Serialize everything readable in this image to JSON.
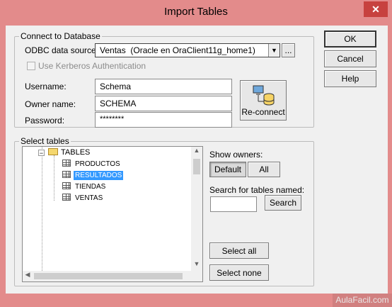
{
  "window": {
    "title": "Import Tables",
    "close_glyph": "✕"
  },
  "connect": {
    "group_label": "Connect to Database",
    "odbc_label": "ODBC data source:",
    "odbc_value": "Ventas  (Oracle en OraClient11g_home1)",
    "browse_label": "...",
    "kerberos_label": "Use Kerberos Authentication",
    "kerberos_checked": false,
    "username_label": "Username:",
    "username_value": "Schema",
    "owner_label": "Owner name:",
    "owner_value": "SCHEMA",
    "password_label": "Password:",
    "password_value": "********",
    "reconnect_label": "Re-connect"
  },
  "buttons": {
    "ok": "OK",
    "cancel": "Cancel",
    "help": "Help"
  },
  "select_tables": {
    "group_label": "Select tables",
    "tree": {
      "root": "TABLES",
      "items": [
        {
          "label": "PRODUCTOS",
          "selected": false
        },
        {
          "label": "RESULTADOS",
          "selected": true
        },
        {
          "label": "TIENDAS",
          "selected": false
        },
        {
          "label": "VENTAS",
          "selected": false
        }
      ]
    },
    "show_owners_label": "Show owners:",
    "default_label": "Default",
    "all_label": "All",
    "search_label": "Search for tables named:",
    "search_value": "",
    "search_button": "Search",
    "select_all": "Select all",
    "select_none": "Select none"
  },
  "status": {
    "watermark": "AulaFacil.com"
  },
  "colors": {
    "titlebar": "#e38b8b",
    "close": "#c7423f",
    "selection": "#3399ff"
  }
}
